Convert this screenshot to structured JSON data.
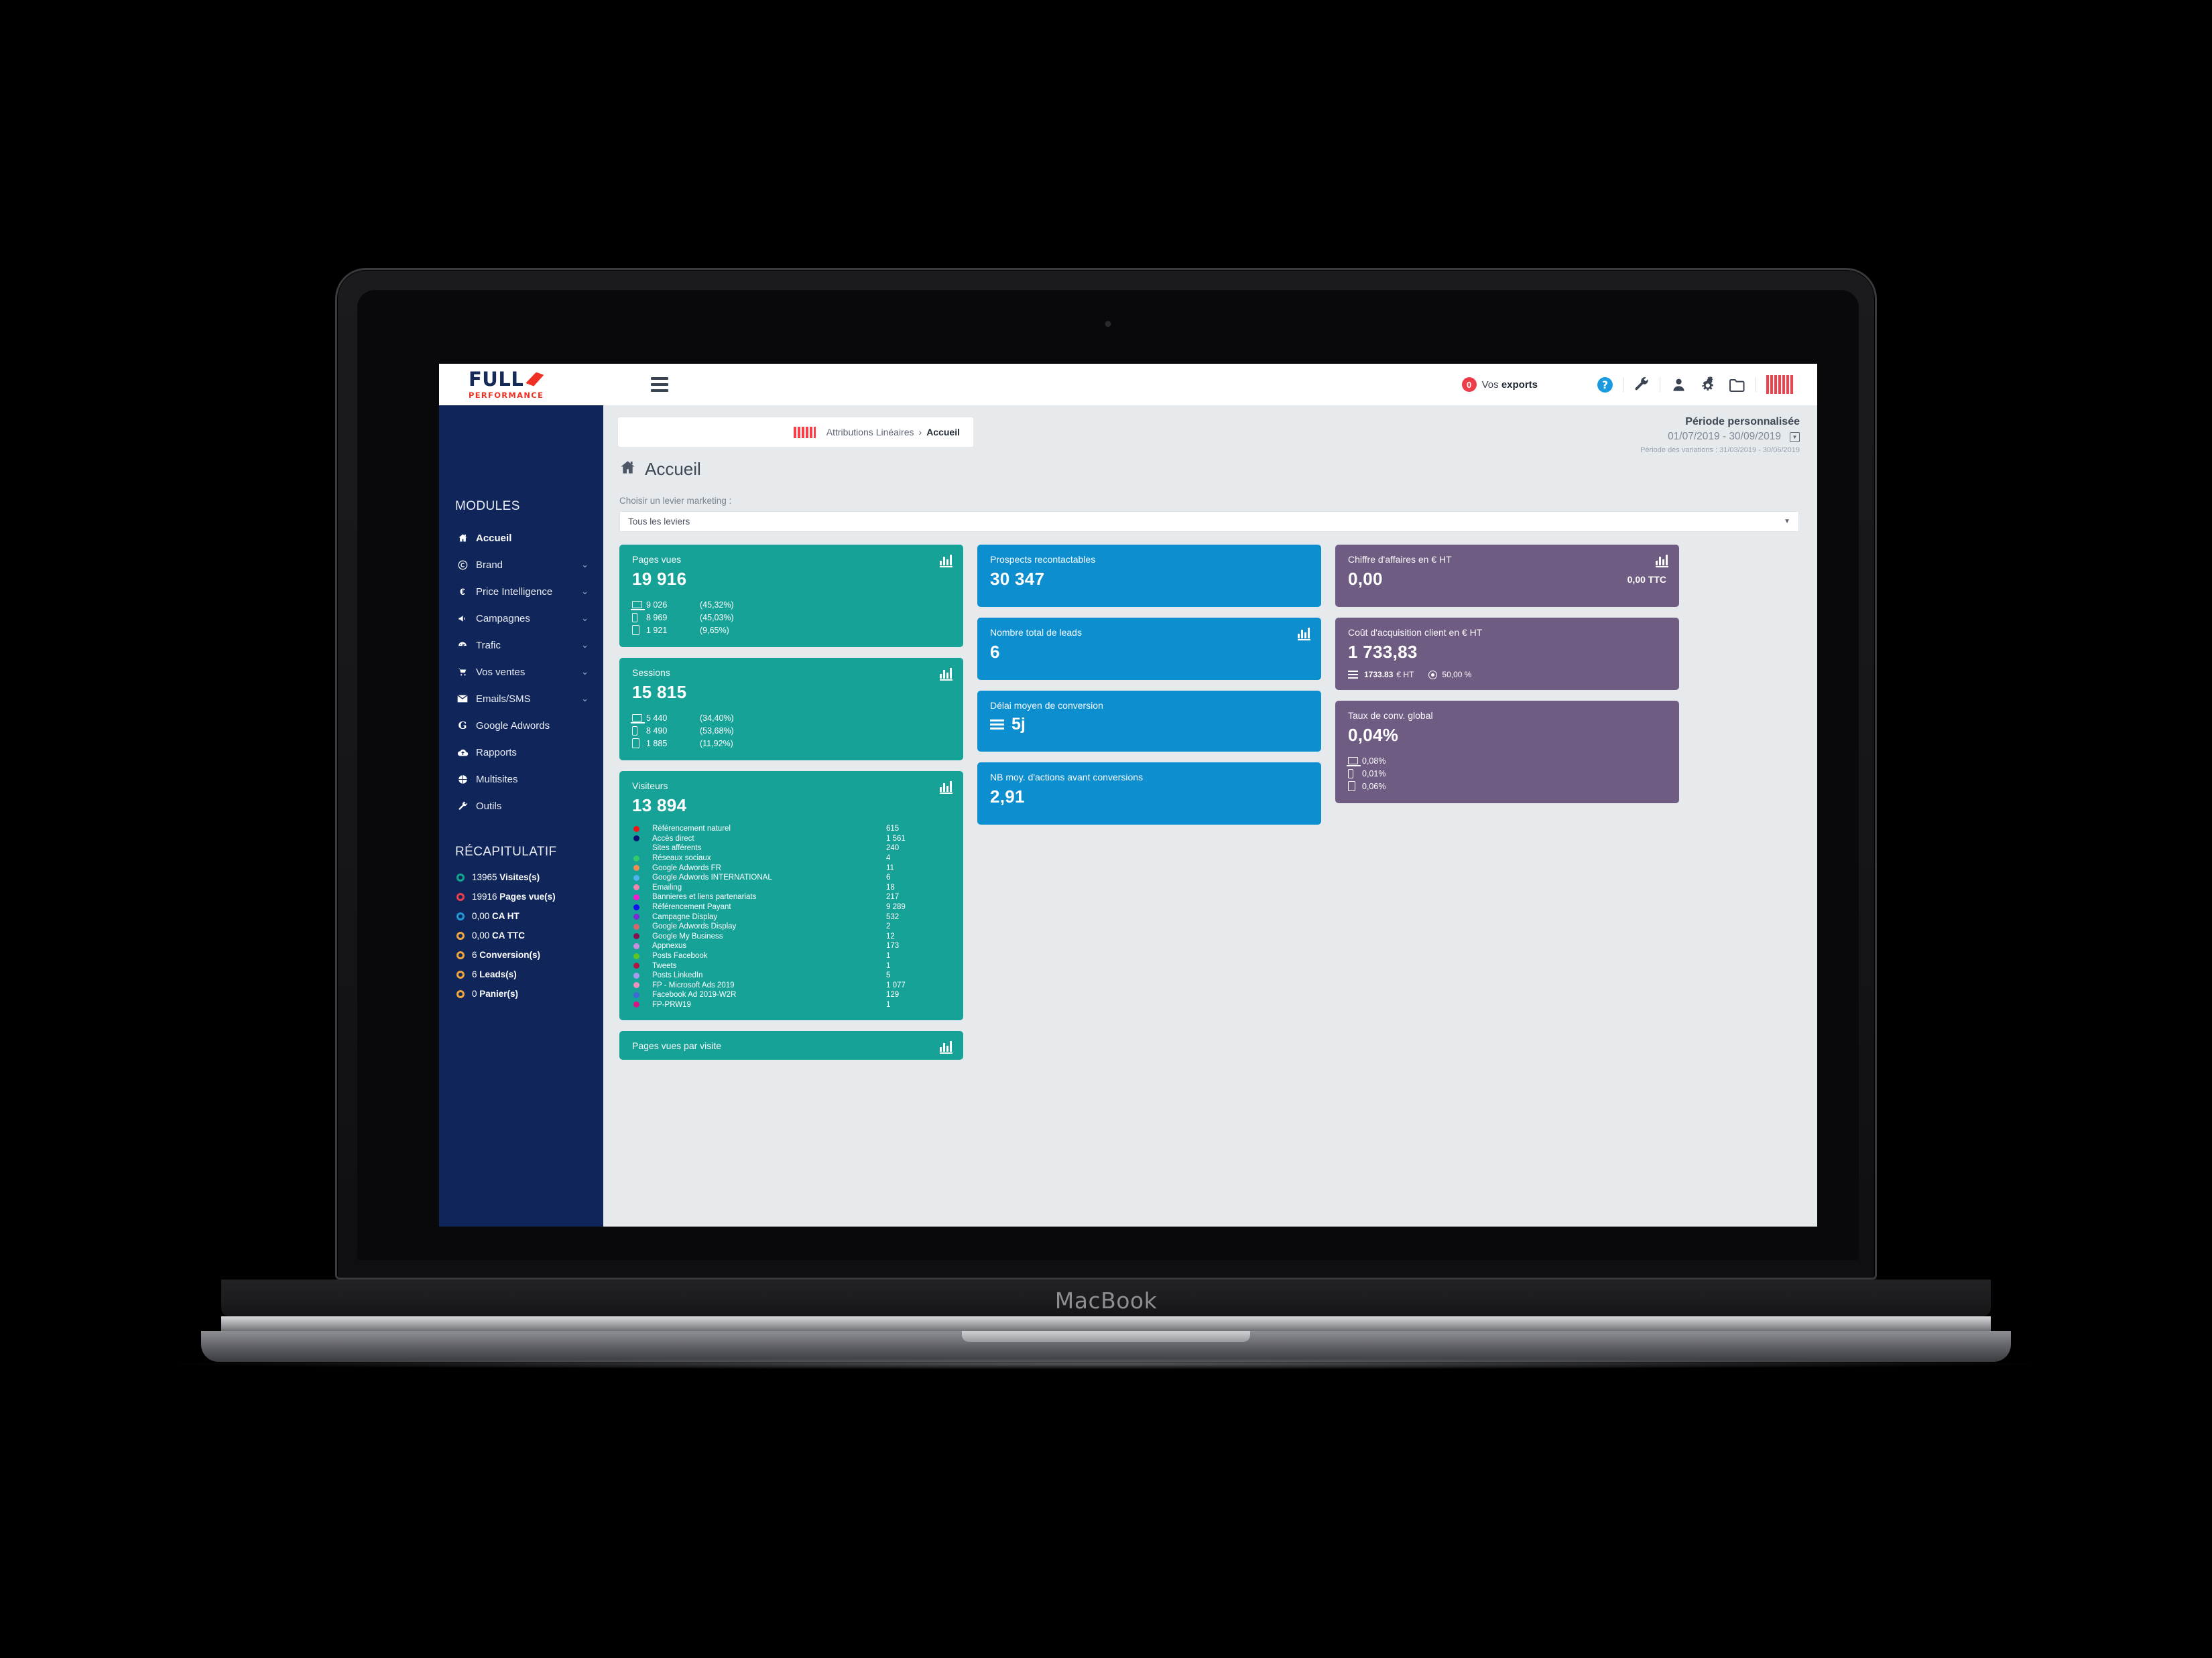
{
  "device": {
    "wordmark": "MacBook"
  },
  "topbar": {
    "logo_main": "FULL",
    "logo_sub": "PERFORMANCE",
    "exports_count": "0",
    "exports_label_prefix": "Vos ",
    "exports_label_strong": "exports",
    "icons": [
      "help-icon",
      "wrench-icon",
      "user-icon",
      "gears-icon",
      "folder-icon",
      "barcode-icon"
    ]
  },
  "sidebar": {
    "modules_heading": "MODULES",
    "items": [
      {
        "label": "Accueil",
        "icon": "home-icon",
        "active": true,
        "caret": false
      },
      {
        "label": "Brand",
        "icon": "copyright-icon",
        "active": false,
        "caret": true
      },
      {
        "label": "Price Intelligence",
        "icon": "euro-icon",
        "active": false,
        "caret": true
      },
      {
        "label": "Campagnes",
        "icon": "megaphone-icon",
        "active": false,
        "caret": true
      },
      {
        "label": "Trafic",
        "icon": "gauge-icon",
        "active": false,
        "caret": true
      },
      {
        "label": "Vos ventes",
        "icon": "cart-icon",
        "active": false,
        "caret": true
      },
      {
        "label": "Emails/SMS",
        "icon": "envelope-icon",
        "active": false,
        "caret": true
      },
      {
        "label": "Google Adwords",
        "icon": "google-icon",
        "active": false,
        "caret": false
      },
      {
        "label": "Rapports",
        "icon": "cloud-up-icon",
        "active": false,
        "caret": false
      },
      {
        "label": "Multisites",
        "icon": "globe-icon",
        "active": false,
        "caret": false
      },
      {
        "label": "Outils",
        "icon": "wrench-icon",
        "active": false,
        "caret": false
      }
    ],
    "recap_heading": "RÉCAPITULATIF",
    "recap_items": [
      {
        "value": "13965",
        "label": "Visites(s)",
        "color": "#13a890"
      },
      {
        "value": "19916",
        "label": "Pages vue(s)",
        "color": "#ee3d4a"
      },
      {
        "value": "0,00",
        "label": "CA HT",
        "color": "#1f9ad6"
      },
      {
        "value": "0,00",
        "label": "CA TTC",
        "color": "#f0a63c"
      },
      {
        "value": "6",
        "label": "Conversion(s)",
        "color": "#f0a63c"
      },
      {
        "value": "6",
        "label": "Leads(s)",
        "color": "#f0a63c"
      },
      {
        "value": "0",
        "label": "Panier(s)",
        "color": "#f0a63c"
      }
    ]
  },
  "breadcrumb": {
    "parent": "Attributions Linéaires",
    "separator": "›",
    "current": "Accueil"
  },
  "period": {
    "title": "Période personnalisée",
    "range": "01/07/2019 - 30/09/2019",
    "variation": "Période des variations : 31/03/2019 - 30/06/2019"
  },
  "page": {
    "title": "Accueil"
  },
  "lever": {
    "label": "Choisir un levier marketing :",
    "value": "Tous les leviers"
  },
  "cards": {
    "pages_vues": {
      "title": "Pages vues",
      "value": "19 916",
      "devices": [
        {
          "device": "desktop",
          "count": "9 026",
          "pct": "(45,32%)"
        },
        {
          "device": "mobile",
          "count": "8 969",
          "pct": "(45,03%)"
        },
        {
          "device": "tablet",
          "count": "1 921",
          "pct": "(9,65%)"
        }
      ]
    },
    "sessions": {
      "title": "Sessions",
      "value": "15 815",
      "devices": [
        {
          "device": "desktop",
          "count": "5 440",
          "pct": "(34,40%)"
        },
        {
          "device": "mobile",
          "count": "8 490",
          "pct": "(53,68%)"
        },
        {
          "device": "tablet",
          "count": "1 885",
          "pct": "(11,92%)"
        }
      ]
    },
    "visiteurs": {
      "title": "Visiteurs",
      "value": "13 894",
      "channels": [
        {
          "name": "Référencement naturel",
          "value": "615",
          "color": "#f21313"
        },
        {
          "name": "Accès direct",
          "value": "1 561",
          "color": "#0b1570"
        },
        {
          "name": "Sites afférents",
          "value": "240",
          "color": "#f6b košt"
        },
        {
          "name": "Réseaux sociaux",
          "value": "4",
          "color": "#34c86a"
        },
        {
          "name": "Google Adwords FR",
          "value": "11",
          "color": "#ef8c54"
        },
        {
          "name": "Google Adwords INTERNATIONAL",
          "value": "6",
          "color": "#4fb3ee"
        },
        {
          "name": "Emailing",
          "value": "18",
          "color": "#f384ad"
        },
        {
          "name": "Bannieres et liens partenariats",
          "value": "217",
          "color": "#f61ad2"
        },
        {
          "name": "Référencement Payant",
          "value": "9 289",
          "color": "#1414f0"
        },
        {
          "name": "Campagne Display",
          "value": "532",
          "color": "#7d2bd1"
        },
        {
          "name": "Google Adwords Display",
          "value": "2",
          "color": "#d4666e"
        },
        {
          "name": "Google My Business",
          "value": "12",
          "color": "#87104f"
        },
        {
          "name": "Appnexus",
          "value": "173",
          "color": "#cb8ddd"
        },
        {
          "name": "Posts Facebook",
          "value": "1",
          "color": "#5ec420"
        },
        {
          "name": "Tweets",
          "value": "1",
          "color": "#b11442"
        },
        {
          "name": "Posts LinkedIn",
          "value": "5",
          "color": "#a99af0"
        },
        {
          "name": "FP - Microsoft Ads 2019",
          "value": "1 077",
          "color": "#f291bf"
        },
        {
          "name": "Facebook Ad 2019-W2R",
          "value": "129",
          "color": "#4069d6"
        },
        {
          "name": "FP-PRW19",
          "value": "1",
          "color": "#da1484"
        }
      ]
    },
    "pages_par_visite": {
      "title": "Pages vues par visite"
    },
    "prospects": {
      "title": "Prospects recontactables",
      "value": "30 347"
    },
    "leads": {
      "title": "Nombre total de leads",
      "value": "6"
    },
    "delai": {
      "title": "Délai moyen de conversion",
      "value": "5j"
    },
    "nb_actions": {
      "title": "NB moy. d'actions avant conversions",
      "value": "2,91"
    },
    "chiffre_affaires": {
      "title": "Chiffre d'affaires en € HT",
      "value": "0,00",
      "ttc": "0,00 TTC"
    },
    "cout_acquisition": {
      "title": "Coût d'acquisition client en € HT",
      "value": "1 733,83",
      "sub_amount": "1733.83",
      "sub_unit": "€ HT",
      "sub_pct": "50,00 %"
    },
    "taux_conv": {
      "title": "Taux de conv. global",
      "value": "0,04%",
      "devices": [
        {
          "device": "desktop",
          "pct": "0,08%"
        },
        {
          "device": "mobile",
          "pct": "0,01%"
        },
        {
          "device": "tablet",
          "pct": "0,06%"
        }
      ]
    }
  }
}
